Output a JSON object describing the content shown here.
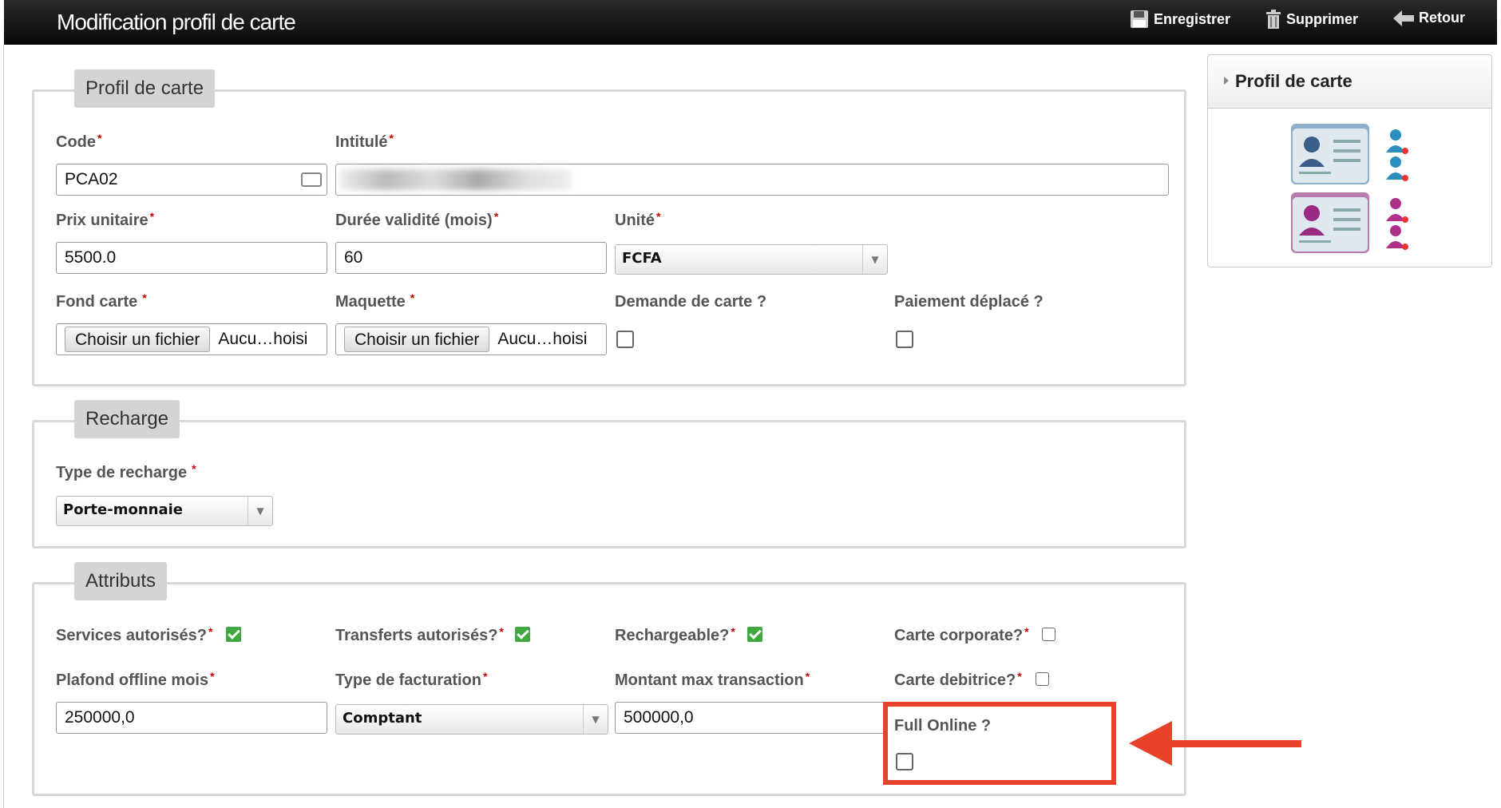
{
  "header": {
    "title": "Modification profil de carte",
    "save_label": "Enregistrer",
    "delete_label": "Supprimer",
    "back_label": "Retour"
  },
  "profil": {
    "legend": "Profil de carte",
    "code_label": "Code",
    "code_value": "PCA02",
    "intitule_label": "Intitulé",
    "intitule_value": "",
    "prix_label": "Prix unitaire",
    "prix_value": "5500.0",
    "duree_label": "Durée validité (mois)",
    "duree_value": "60",
    "unite_label": "Unité",
    "unite_value": "FCFA",
    "fond_label": "Fond carte",
    "maquette_label": "Maquette",
    "file_button": "Choisir un fichier",
    "file_status": "Aucu…hoisi",
    "demande_label": "Demande de carte ?",
    "paiement_label": "Paiement déplacé ?"
  },
  "recharge": {
    "legend": "Recharge",
    "type_label": "Type de recharge",
    "type_value": "Porte-monnaie"
  },
  "attributs": {
    "legend": "Attributs",
    "services_label": "Services autorisés?",
    "transferts_label": "Transferts autorisés?",
    "rechargeable_label": "Rechargeable?",
    "corporate_label": "Carte corporate?",
    "plafond_label": "Plafond offline mois",
    "plafond_value": "250000,0",
    "facturation_label": "Type de facturation",
    "facturation_value": "Comptant",
    "montant_label": "Montant max transaction",
    "montant_value": "500000,0",
    "debitrice_label": "Carte debitrice?",
    "full_online_label": "Full Online ?"
  },
  "side": {
    "title": "Profil de carte"
  },
  "required_mark": "*",
  "colors": {
    "accent_red": "#e8432a",
    "check_green": "#3fa83f",
    "male_blue": "#2a8fbf",
    "female_purple": "#b0308a"
  }
}
